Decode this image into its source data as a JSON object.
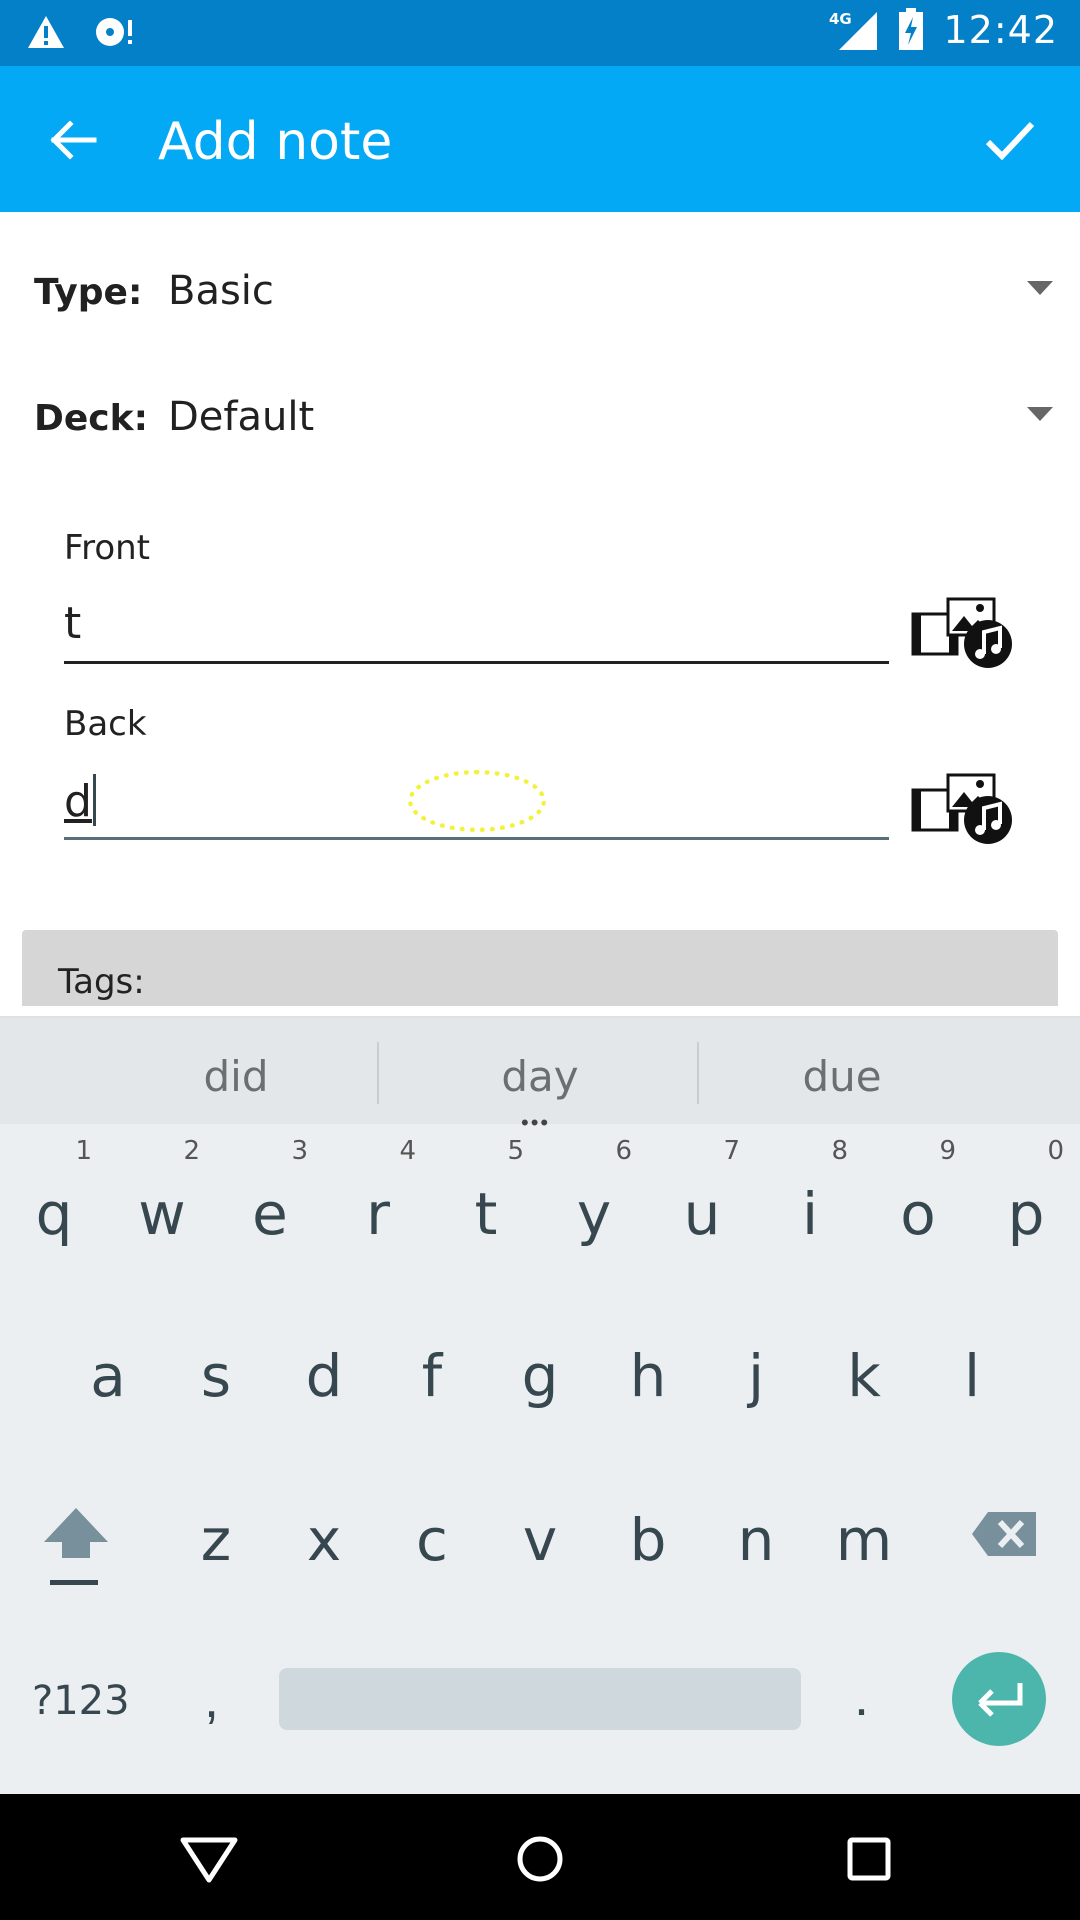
{
  "status_bar": {
    "time": "12:42",
    "network": "4G"
  },
  "app_bar": {
    "title": "Add note"
  },
  "form": {
    "type": {
      "label": "Type:",
      "value": "Basic"
    },
    "deck": {
      "label": "Deck:",
      "value": "Default"
    },
    "fields": [
      {
        "label": "Front",
        "value": "t"
      },
      {
        "label": "Back",
        "value": "d"
      }
    ],
    "tags_label": "Tags:"
  },
  "keyboard": {
    "suggestions": [
      "did",
      "day",
      "due"
    ],
    "rows": [
      [
        "q",
        "w",
        "e",
        "r",
        "t",
        "y",
        "u",
        "i",
        "o",
        "p"
      ],
      [
        "a",
        "s",
        "d",
        "f",
        "g",
        "h",
        "j",
        "k",
        "l"
      ],
      [
        "z",
        "x",
        "c",
        "v",
        "b",
        "n",
        "m"
      ]
    ],
    "numbers": [
      "1",
      "2",
      "3",
      "4",
      "5",
      "6",
      "7",
      "8",
      "9",
      "0"
    ],
    "symbols_key": "?123",
    "comma": ",",
    "period": "."
  },
  "colors": {
    "status_bar": "#0480c9",
    "app_bar": "#03a9f4",
    "enter_key": "#4db6ac",
    "keyboard_bg": "#eceff1"
  }
}
